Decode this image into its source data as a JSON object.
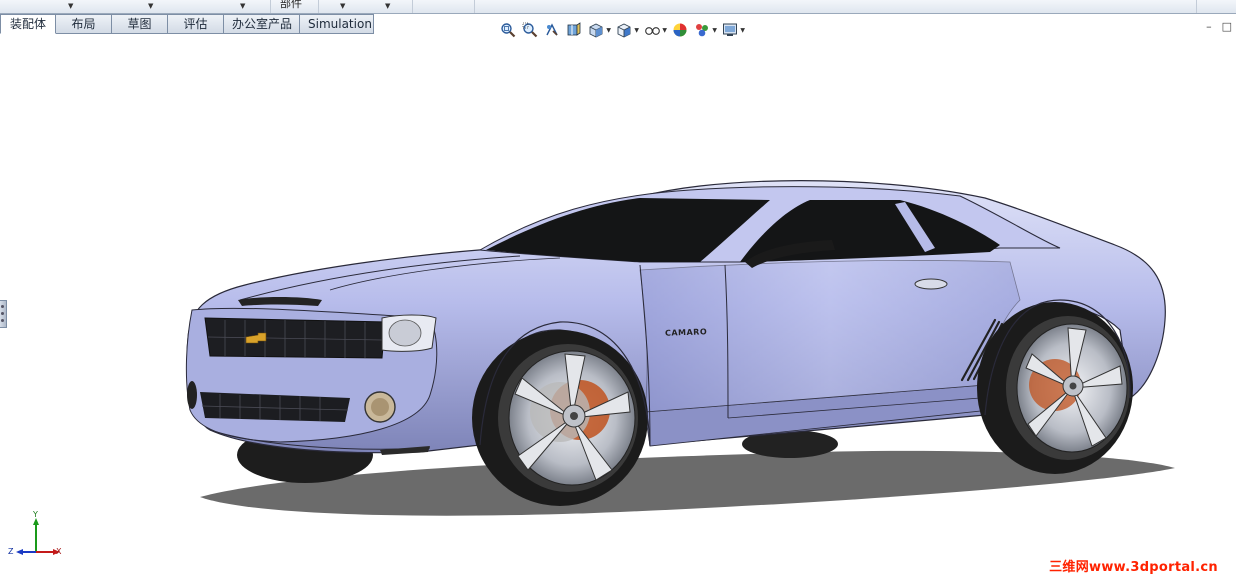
{
  "top_strip": {
    "label": "部件"
  },
  "tabs": [
    {
      "label": "装配体",
      "active": true
    },
    {
      "label": "布局",
      "active": false
    },
    {
      "label": "草图",
      "active": false
    },
    {
      "label": "评估",
      "active": false
    },
    {
      "label": "办公室产品",
      "active": false
    },
    {
      "label": "Simulation",
      "active": false
    }
  ],
  "heads_up_toolbar": [
    "zoom-to-fit-icon",
    "zoom-to-area-icon",
    "previous-view-icon",
    "section-view-icon",
    "view-orientation-icon",
    "display-style-icon",
    "hide-show-items-icon",
    "edit-appearance-icon",
    "apply-scene-icon",
    "view-settings-icon"
  ],
  "window_controls": {
    "restore": "–",
    "maximize": "□"
  },
  "triad": {
    "x": "X",
    "y": "Y",
    "z": "Z"
  },
  "model": {
    "badge": "CAMARO"
  },
  "watermark": "三维网www.3dportal.cn",
  "colors": {
    "body": "#aab0e3",
    "glass": "#141516",
    "tire": "#1b1b1b",
    "rim": "#c9ccd3",
    "brake": "#c0521e",
    "shadow": "#5e5e5e"
  }
}
